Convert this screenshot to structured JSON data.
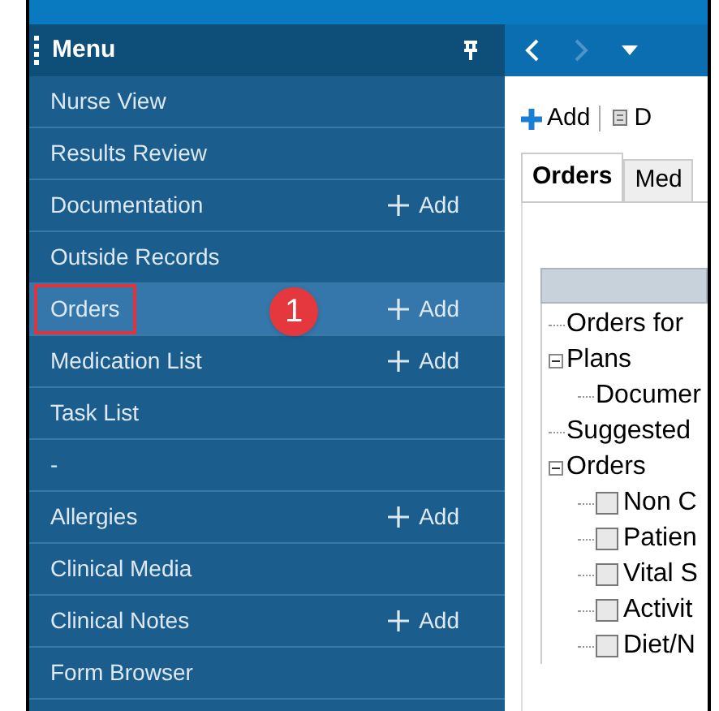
{
  "menu": {
    "title": "Menu"
  },
  "menu_items": [
    {
      "label": "Nurse View",
      "selected": false
    },
    {
      "label": "Results Review",
      "selected": false
    },
    {
      "label": "Documentation",
      "add": "Add",
      "selected": false
    },
    {
      "label": "Outside Records",
      "selected": false
    },
    {
      "label": "Orders",
      "add": "Add",
      "selected": true
    },
    {
      "label": "Medication List",
      "add": "Add",
      "selected": false
    },
    {
      "label": "Task List",
      "selected": false
    },
    {
      "label": "-",
      "selected": false
    },
    {
      "label": "Allergies",
      "add": "Add",
      "selected": false
    },
    {
      "label": "Clinical Media",
      "selected": false
    },
    {
      "label": "Clinical Notes",
      "add": "Add",
      "selected": false
    },
    {
      "label": "Form Browser",
      "selected": false
    }
  ],
  "callout": {
    "number": "1"
  },
  "toolbar": {
    "add": "Add",
    "document": "D"
  },
  "tabs": [
    {
      "label": "Orders",
      "selected": true
    },
    {
      "label": "Med",
      "selected": false
    }
  ],
  "tree": [
    {
      "label": "Orders for"
    },
    {
      "label": "Plans",
      "expanded": true,
      "children": [
        {
          "label": "Documer"
        }
      ]
    },
    {
      "label": "Suggested"
    },
    {
      "label": "Orders",
      "expanded": true,
      "children": [
        {
          "label": "Non C",
          "checked": false
        },
        {
          "label": "Patien",
          "checked": false
        },
        {
          "label": "Vital S",
          "checked": false
        },
        {
          "label": "Activit",
          "checked": false
        },
        {
          "label": "Diet/N",
          "checked": false
        }
      ]
    }
  ]
}
